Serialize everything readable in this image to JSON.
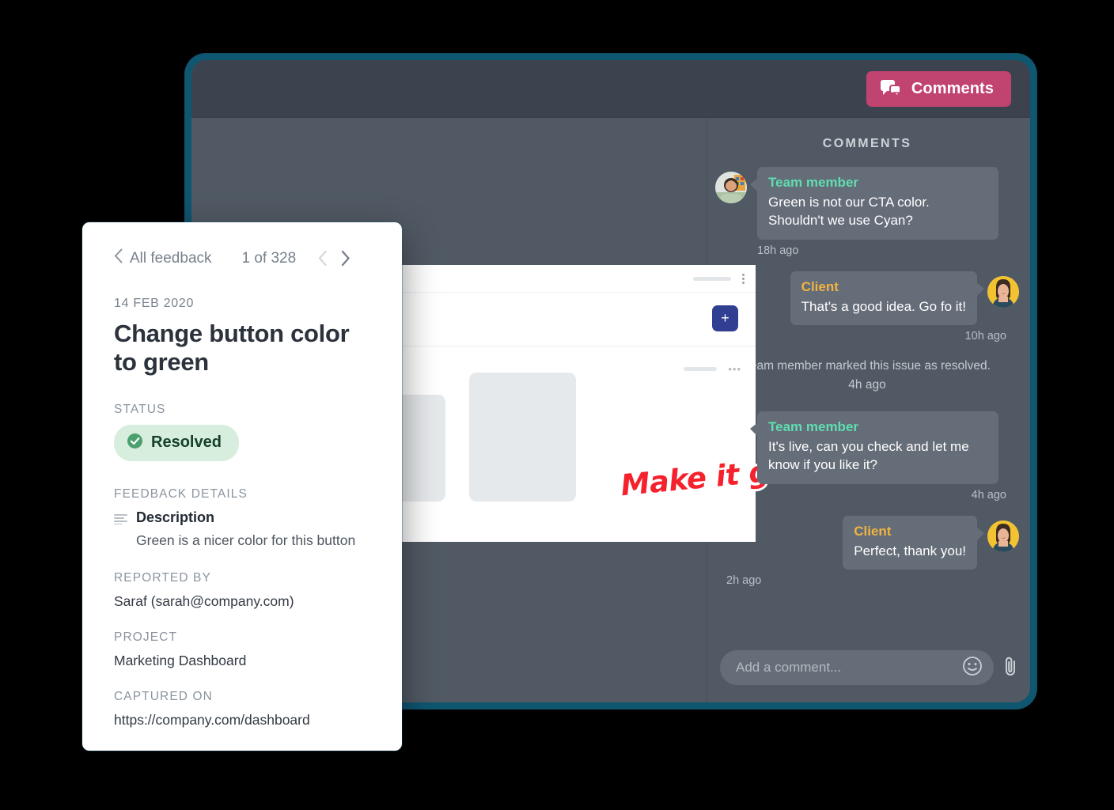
{
  "app": {
    "topbar": {
      "comments_button_label": "Comments"
    },
    "comments_panel": {
      "heading": "COMMENTS",
      "messages": [
        {
          "side": "left",
          "sender": "Team member",
          "sender_role": "team",
          "text": "Green is not our CTA color. Shouldn't we use Cyan?",
          "time": "18h ago"
        },
        {
          "side": "right",
          "sender": "Client",
          "sender_role": "client",
          "text": "That's a good idea. Go fo it!",
          "time": "10h ago"
        },
        {
          "side": "left",
          "sender": "Team member",
          "sender_role": "team",
          "text": "It's live, can you check and let me know if you like it?",
          "time": "4h ago"
        },
        {
          "side": "right",
          "sender": "Client",
          "sender_role": "client",
          "text": "Perfect, thank you!",
          "time": "2h ago"
        }
      ],
      "system_note": {
        "text": "Team member marked this issue as resolved.",
        "time": "4h ago"
      },
      "composer": {
        "placeholder": "Add a comment...",
        "emoji_icon": "smiley-icon",
        "attach_icon": "paperclip-icon"
      }
    },
    "preview": {
      "annotation_text": "Make it green",
      "plus_button_label": "+",
      "annotation_color": "#f5222d",
      "plus_button_color": "#303f91"
    }
  },
  "detail_card": {
    "back_label": "All feedback",
    "counter": "1 of 328",
    "prev_icon": "chevron-left-icon",
    "next_icon": "chevron-right-icon",
    "date": "14 FEB 2020",
    "title": "Change button color to green",
    "status_label": "STATUS",
    "status_value": "Resolved",
    "status_color": "#d7eede",
    "details_label": "FEEDBACK DETAILS",
    "description_title": "Description",
    "description_text": "Green is a nicer color for this button",
    "reported_by_label": "REPORTED BY",
    "reported_by_value": "Saraf (sarah@company.com)",
    "project_label": "PROJECT",
    "project_value": "Marketing Dashboard",
    "captured_on_label": "CAPTURED ON",
    "captured_on_value": "https://company.com/dashboard"
  },
  "theme": {
    "accent_pink": "#c04370",
    "frame_teal": "#0f5671",
    "panel_dark": "#515a64",
    "topbar_dark": "#3d434e",
    "bubble_gray": "#656d78",
    "team_green": "#5fdeb0",
    "client_yellow": "#f2b340"
  }
}
